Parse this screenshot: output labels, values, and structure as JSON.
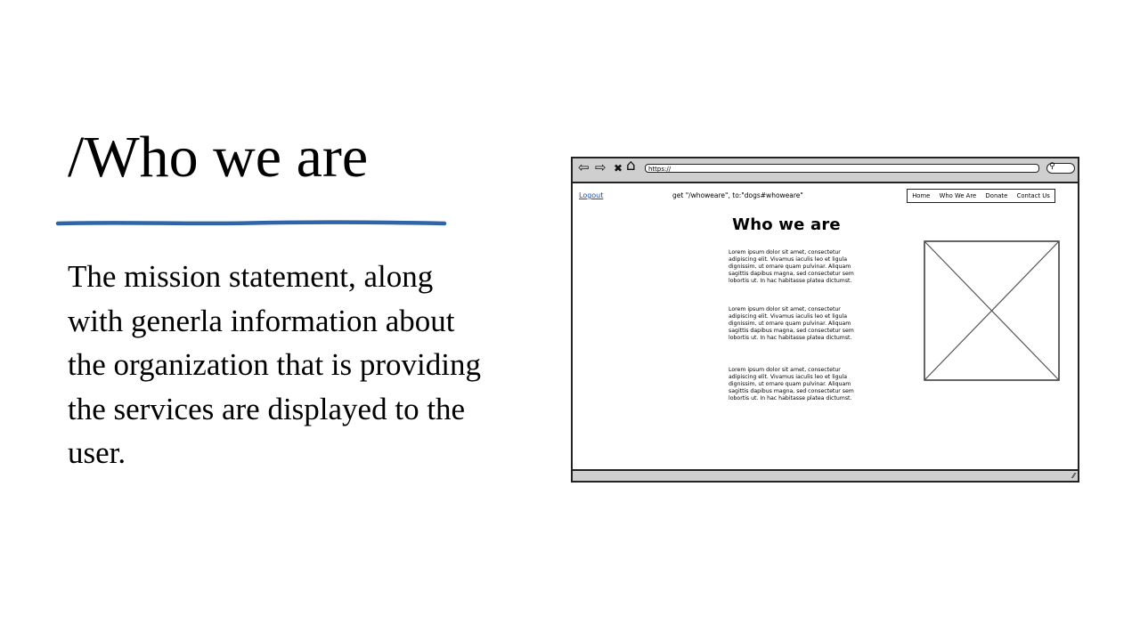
{
  "slide": {
    "title": "/Who we are",
    "body": "The mission statement, along with generla information about the organization that is providing the services are displayed to the user.",
    "accent_color": "#2f64a6"
  },
  "wireframe": {
    "toolbar": {
      "icons": [
        "back-arrow-icon",
        "forward-arrow-icon",
        "close-icon",
        "home-icon",
        "search-icon"
      ],
      "back_glyph": "⇦",
      "forward_glyph": "⇨",
      "close_glyph": "✖",
      "home_glyph": "⌂",
      "url": "https://",
      "search_glyph": "⚲"
    },
    "logout_label": "Logout",
    "route_text": "get \"/whoweare\", to:\"dogs#whoweare\"",
    "nav": [
      "Home",
      "Who We Are",
      "Donate",
      "Contact Us"
    ],
    "heading": "Who we are",
    "paragraphs": [
      "Lorem ipsum dolor sit amet, consectetur adipiscing elit. Vivamus iaculis leo et ligula dignissim, ut ornare quam pulvinar. Aliquam sagittis dapibus magna, sed consectetur sem lobortis ut. In hac habitasse platea dictumst.",
      "Lorem ipsum dolor sit amet, consectetur adipiscing elit. Vivamus iaculis leo et ligula dignissim, ut ornare quam pulvinar. Aliquam sagittis dapibus magna, sed consectetur sem lobortis ut. In hac habitasse platea dictumst.",
      "Lorem ipsum dolor sit amet, consectetur adipiscing elit. Vivamus iaculis leo et ligula dignissim, ut ornare quam pulvinar. Aliquam sagittis dapibus magna, sed consectetur sem lobortis ut. In hac habitasse platea dictumst."
    ],
    "image_placeholder_icon": "image-placeholder-icon",
    "resize_glyph": "⁄⁄"
  }
}
